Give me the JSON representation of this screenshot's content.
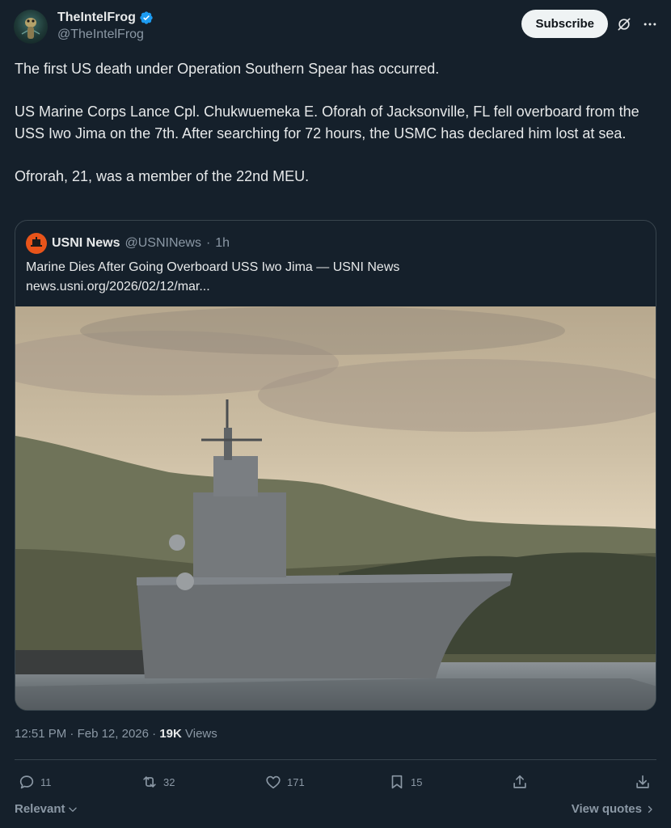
{
  "post": {
    "author_name": "TheIntelFrog",
    "author_handle": "@TheIntelFrog",
    "subscribe_label": "Subscribe",
    "paragraphs": [
      "The first US death under Operation Southern Spear has occurred.",
      "US Marine Corps Lance Cpl. Chukwuemeka E. Oforah of Jacksonville, FL fell overboard from the USS Iwo Jima on the 7th.  After searching for 72 hours, the USMC has declared him lost at sea.",
      "Ofrorah, 21, was a member of the 22nd MEU."
    ],
    "time": "12:51 PM",
    "date": "Feb 12, 2026",
    "views_count": "19K",
    "views_label": "Views"
  },
  "quote": {
    "name": "USNI News",
    "handle": "@USNINews",
    "age": "1h",
    "title": "Marine Dies After Going Overboard USS Iwo Jima — USNI News",
    "link": "news.usni.org/2026/02/12/mar..."
  },
  "actions": {
    "replies": "11",
    "reposts": "32",
    "likes": "171",
    "bookmarks": "15"
  },
  "footer": {
    "relevant_label": "Relevant",
    "view_quotes_label": "View quotes"
  },
  "colors": {
    "background": "#15202b",
    "text": "#e7e9ea",
    "muted": "#8b98a5",
    "verified": "#1d9bf0",
    "border": "#38444d"
  },
  "icons": [
    "verified-badge-icon",
    "grok-icon",
    "more-icon",
    "reply-icon",
    "repost-icon",
    "like-icon",
    "bookmark-icon",
    "share-icon",
    "download-icon",
    "chevron-down-icon",
    "chevron-right-icon"
  ]
}
